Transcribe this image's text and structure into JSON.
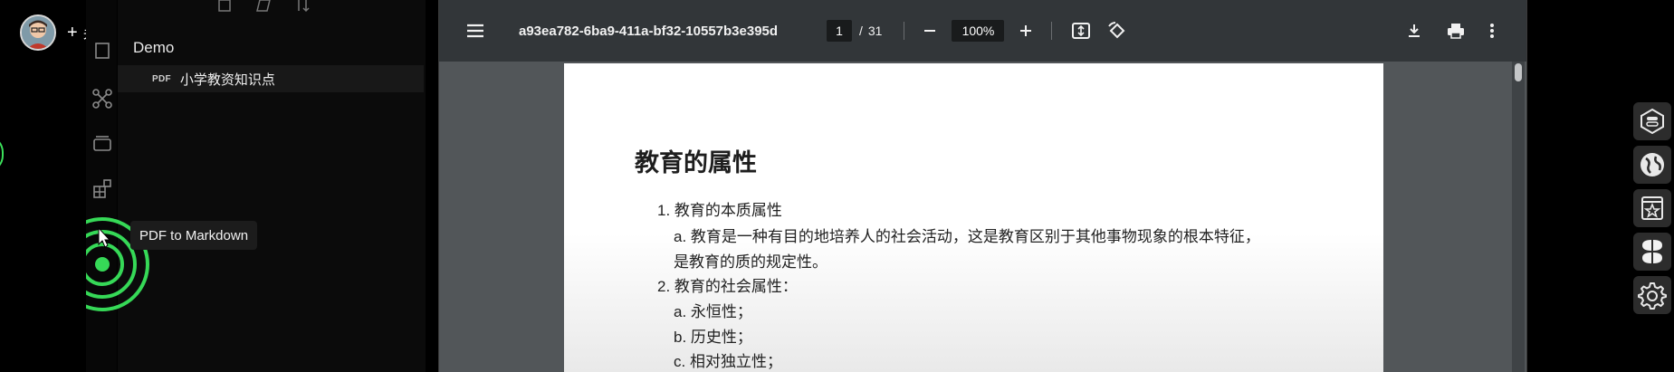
{
  "overlay": {
    "follow_label": "关注",
    "follow_plus": "+"
  },
  "sidebar": {
    "folder": "Demo",
    "file": {
      "tag": "PDF",
      "name": "小学教资知识点"
    },
    "tooltip": "PDF to Markdown"
  },
  "viewer": {
    "title": "a93ea782-6ba9-411a-bf32-10557b3e395d",
    "page_current": "1",
    "page_sep": "/",
    "page_total": "31",
    "zoom": "100%"
  },
  "document": {
    "heading": "教育的属性",
    "lines": [
      "1. 教育的本质属性",
      "a. 教育是一种有目的地培养人的社会活动，这是教育区别于其他事物现象的根本特征，",
      "是教育的质的规定性。",
      "2. 教育的社会属性：",
      "a. 永恒性；",
      "b. 历史性；",
      "c. 相对独立性；"
    ]
  },
  "colors": {
    "accent_green": "#3be05a",
    "toolbar": "#323639",
    "viewer_bg": "#525659"
  },
  "icons": {
    "left": [
      "menu-icon",
      "zoom-out-icon",
      "zoom-in-icon",
      "fit-page-icon",
      "rotate-icon"
    ],
    "right": [
      "download-icon",
      "print-icon",
      "more-vert-icon"
    ],
    "right_toolbar": [
      "toggle-icon",
      "globe-icon",
      "bookmark-star-icon",
      "clover-icon",
      "gear-icon"
    ]
  }
}
